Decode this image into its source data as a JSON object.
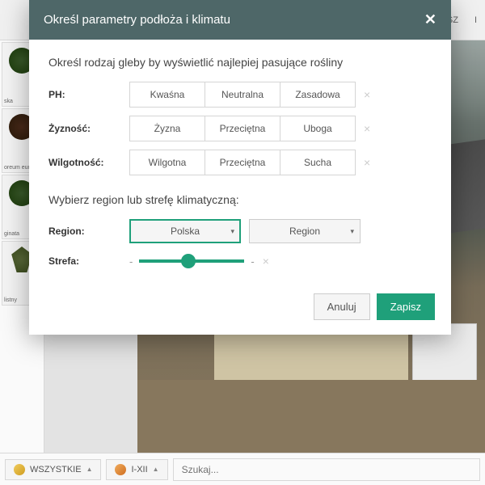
{
  "topbar": {
    "item1": "ISZ",
    "item2": "I"
  },
  "sidebar": {
    "plants": [
      {
        "label": "ska"
      },
      {
        "label": "oreum\neum\""
      },
      {
        "label": "ginata"
      },
      {
        "label": "listny"
      }
    ]
  },
  "bottombar": {
    "filter1": "WSZYSTKIE",
    "filter2": "I-XII",
    "search_placeholder": "Szukaj..."
  },
  "modal": {
    "title": "Określ parametry podłoża i klimatu",
    "soil_heading": "Określ rodzaj gleby by wyświetlić najlepiej pasujące rośliny",
    "rows": {
      "ph": {
        "label": "PH:",
        "opts": [
          "Kwaśna",
          "Neutralna",
          "Zasadowa"
        ]
      },
      "fertility": {
        "label": "Żyzność:",
        "opts": [
          "Żyzna",
          "Przeciętna",
          "Uboga"
        ]
      },
      "moisture": {
        "label": "Wilgotność:",
        "opts": [
          "Wilgotna",
          "Przeciętna",
          "Sucha"
        ]
      }
    },
    "region_heading": "Wybierz region lub strefę klimatyczną:",
    "region_label": "Region:",
    "country_select": "Polska",
    "region_select": "Region",
    "zone_label": "Strefa:",
    "cancel": "Anuluj",
    "save": "Zapisz"
  }
}
